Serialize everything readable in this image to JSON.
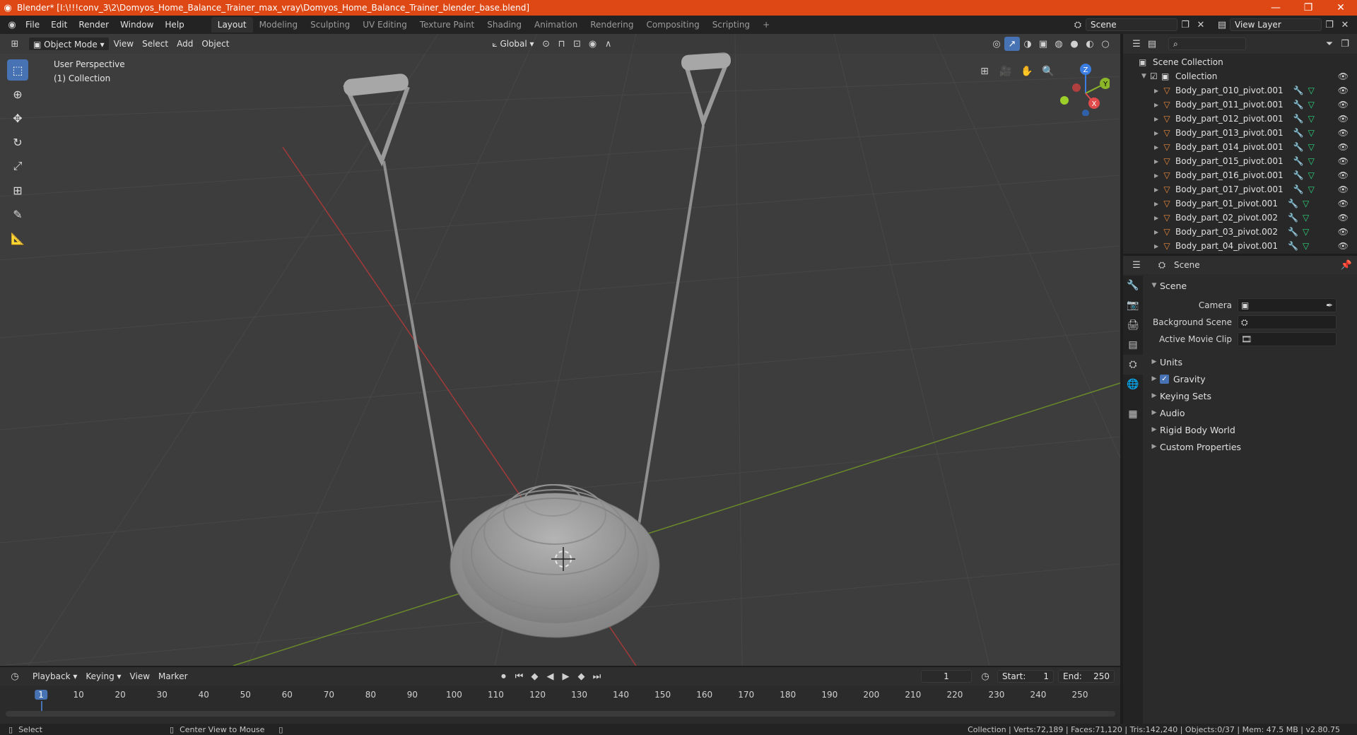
{
  "window": {
    "title": "Blender* [I:\\!!!conv_3\\2\\Domyos_Home_Balance_Trainer_max_vray\\Domyos_Home_Balance_Trainer_blender_base.blend]",
    "controls": [
      "—",
      "❐",
      "✕"
    ]
  },
  "menus": [
    "File",
    "Edit",
    "Render",
    "Window",
    "Help"
  ],
  "workspaces": [
    "Layout",
    "Modeling",
    "Sculpting",
    "UV Editing",
    "Texture Paint",
    "Shading",
    "Animation",
    "Rendering",
    "Compositing",
    "Scripting"
  ],
  "active_workspace": "Layout",
  "add_workspace": "+",
  "scene_selector": "Scene",
  "view_layer_selector": "View Layer",
  "viewport": {
    "mode": "Object Mode",
    "menus": [
      "View",
      "Select",
      "Add",
      "Object"
    ],
    "orientation": "Global",
    "perspective_label": "User Perspective",
    "collection_label": "(1) Collection",
    "gizmo": {
      "z": "Z",
      "y": "Y",
      "x": "X"
    }
  },
  "outliner": {
    "search_placeholder": "",
    "root": "Scene Collection",
    "collection": "Collection",
    "items": [
      "Body_part_010_pivot.001",
      "Body_part_011_pivot.001",
      "Body_part_012_pivot.001",
      "Body_part_013_pivot.001",
      "Body_part_014_pivot.001",
      "Body_part_015_pivot.001",
      "Body_part_016_pivot.001",
      "Body_part_017_pivot.001",
      "Body_part_01_pivot.001",
      "Body_part_02_pivot.002",
      "Body_part_03_pivot.002",
      "Body_part_04_pivot.001"
    ]
  },
  "properties": {
    "context": "Scene",
    "panel": "Scene",
    "fields": [
      {
        "label": "Camera"
      },
      {
        "label": "Background Scene"
      },
      {
        "label": "Active Movie Clip"
      }
    ],
    "sections": [
      "Units",
      "Gravity",
      "Keying Sets",
      "Audio",
      "Rigid Body World",
      "Custom Properties"
    ],
    "gravity_checked": true
  },
  "timeline": {
    "menus": [
      "Playback",
      "Keying",
      "View",
      "Marker"
    ],
    "current_frame": "1",
    "start_label": "Start:",
    "start": "1",
    "end_label": "End:",
    "end": "250",
    "ticks": [
      "1",
      "10",
      "20",
      "30",
      "40",
      "50",
      "60",
      "70",
      "80",
      "90",
      "100",
      "110",
      "120",
      "130",
      "140",
      "150",
      "160",
      "170",
      "180",
      "190",
      "200",
      "210",
      "220",
      "230",
      "240",
      "250"
    ]
  },
  "status": {
    "left": "Select",
    "middle": "Center View to Mouse",
    "right": "Collection | Verts:72,189 | Faces:71,120 | Tris:142,240 | Objects:0/37 | Mem: 47.5 MB | v2.80.75"
  }
}
